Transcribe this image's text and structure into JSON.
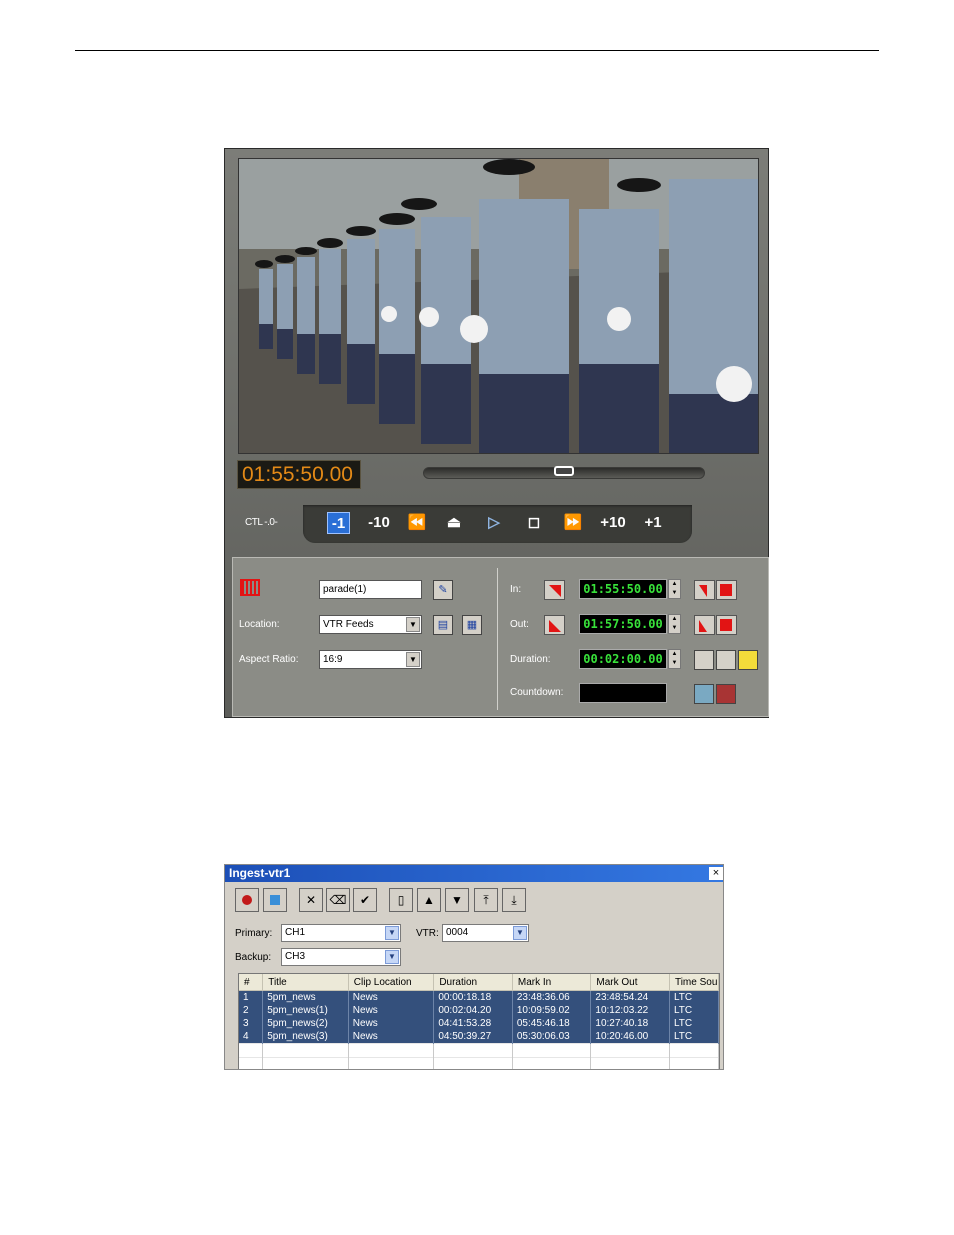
{
  "player": {
    "timecode": "01:55:50.00",
    "ctl_label": "CTL -.0-",
    "transport": [
      {
        "label": "-1",
        "name": "step-back-1-button",
        "active": true
      },
      {
        "label": "-10",
        "name": "step-back-10-button"
      },
      {
        "label": "⏪",
        "name": "rewind-icon"
      },
      {
        "label": "⏏",
        "name": "eject-icon"
      },
      {
        "label": "▷",
        "name": "play-icon"
      },
      {
        "label": "◻",
        "name": "stop-icon"
      },
      {
        "label": "⏩",
        "name": "fast-forward-icon"
      },
      {
        "label": "+10",
        "name": "step-forward-10-button"
      },
      {
        "label": "+1",
        "name": "step-forward-1-button"
      }
    ],
    "scrub_position": 0.5,
    "clip_name": "parade(1)",
    "location_label": "Location:",
    "location_value": "VTR Feeds",
    "aspect_label": "Aspect Ratio:",
    "aspect_value": "16:9",
    "in_label": "In:",
    "in_value": "01:55:50.00",
    "out_label": "Out:",
    "out_value": "01:57:50.00",
    "duration_label": "Duration:",
    "duration_value": "00:02:00.00",
    "countdown_label": "Countdown:",
    "countdown_value": ""
  },
  "ingest": {
    "title": "Ingest-vtr1",
    "close": "×",
    "primary_label": "Primary:",
    "primary_value": "CH1",
    "vtr_label": "VTR:",
    "vtr_value": "0004",
    "backup_label": "Backup:",
    "backup_value": "CH3",
    "columns": [
      "#",
      "Title",
      "Clip Location",
      "Duration",
      "Mark In",
      "Mark Out",
      "Time Sou"
    ],
    "rows": [
      [
        "1",
        "5pm_news",
        "News",
        "00:00:18.18",
        "23:48:36.06",
        "23:48:54.24",
        "LTC"
      ],
      [
        "2",
        "5pm_news(1)",
        "News",
        "00:02:04.20",
        "10:09:59.02",
        "10:12:03.22",
        "LTC"
      ],
      [
        "3",
        "5pm_news(2)",
        "News",
        "04:41:53.28",
        "05:45:46.18",
        "10:27:40.18",
        "LTC"
      ],
      [
        "4",
        "5pm_news(3)",
        "News",
        "04:50:39.27",
        "05:30:06.03",
        "10:20:46.00",
        "LTC"
      ]
    ]
  }
}
